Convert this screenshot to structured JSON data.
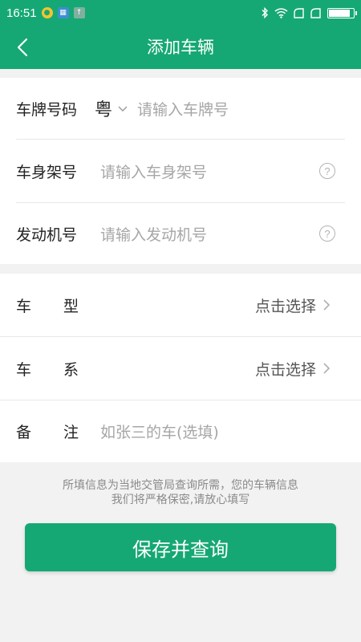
{
  "status_bar": {
    "time": "16:51"
  },
  "nav": {
    "title": "添加车辆"
  },
  "form": {
    "plate": {
      "label": "车牌号码",
      "province": "粤",
      "placeholder": "请输入车牌号"
    },
    "frame": {
      "label": "车身架号",
      "placeholder": "请输入车身架号"
    },
    "engine": {
      "label": "发动机号",
      "placeholder": "请输入发动机号"
    },
    "model": {
      "label_1": "车",
      "label_2": "型",
      "value": "点击选择"
    },
    "series": {
      "label_1": "车",
      "label_2": "系",
      "value": "点击选择"
    },
    "remark": {
      "label_1": "备",
      "label_2": "注",
      "placeholder": "如张三的车(选填)"
    }
  },
  "notice": {
    "line1": "所填信息为当地交管局查询所需，您的车辆信息",
    "line2": "我们将严格保密,请放心填写"
  },
  "save_button": {
    "label": "保存并查询"
  },
  "colors": {
    "brand": "#16a874",
    "background": "#f2f2f2"
  }
}
